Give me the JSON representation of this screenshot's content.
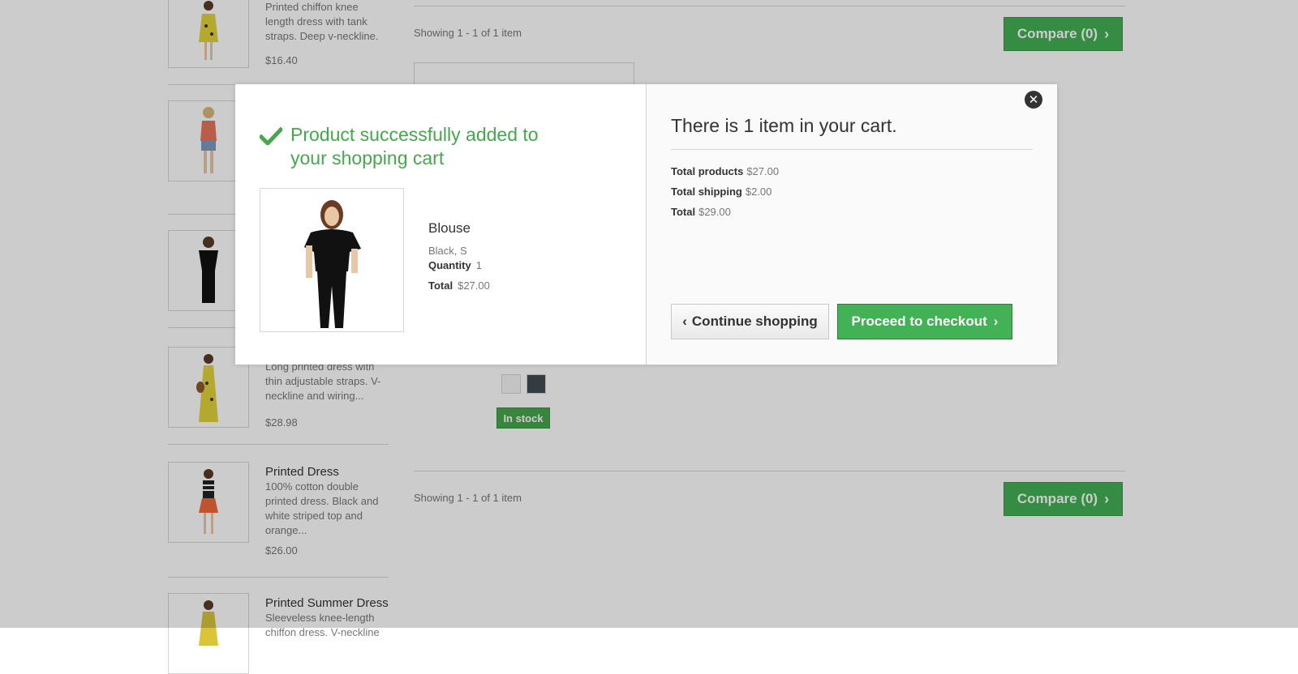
{
  "sidebar": {
    "items": [
      {
        "name": "",
        "desc": "Printed chiffon knee length dress with tank straps. Deep v-neckline.",
        "price": "$16.40"
      },
      {
        "name": "",
        "desc": "",
        "price": ""
      },
      {
        "name": "",
        "desc": "",
        "price": ""
      },
      {
        "name": "",
        "desc": "Long printed dress with thin adjustable straps. V-neckline and wiring...",
        "price": "$28.98"
      },
      {
        "name": "Printed Dress",
        "desc": "100% cotton double printed dress. Black and white striped top and orange...",
        "price": "$26.00"
      },
      {
        "name": "Printed Summer Dress",
        "desc": "Sleeveless knee-length chiffon dress. V-neckline",
        "price": ""
      }
    ]
  },
  "listing": {
    "showing_top": "Showing 1 - 1 of 1 item",
    "showing_bottom": "Showing 1 - 1 of 1 item",
    "compare_label": "Compare (0)",
    "stock_label": "In stock",
    "swatch_colors": [
      "#f5f5f5",
      "#434a54"
    ]
  },
  "modal": {
    "success_title": "Product successfully added to your shopping cart",
    "product": {
      "name": "Blouse",
      "attributes": "Black, S",
      "quantity_label": "Quantity",
      "quantity": "1",
      "total_label": "Total",
      "total": "$27.00"
    },
    "cart": {
      "title": "There is 1 item in your cart.",
      "total_products_label": "Total products",
      "total_products": "$27.00",
      "total_shipping_label": "Total shipping",
      "total_shipping": "$2.00",
      "total_label": "Total",
      "total": "$29.00"
    },
    "continue_label": "Continue shopping",
    "checkout_label": "Proceed to checkout"
  },
  "colors": {
    "accent_green": "#46a74e",
    "button_green": "#43b155"
  }
}
